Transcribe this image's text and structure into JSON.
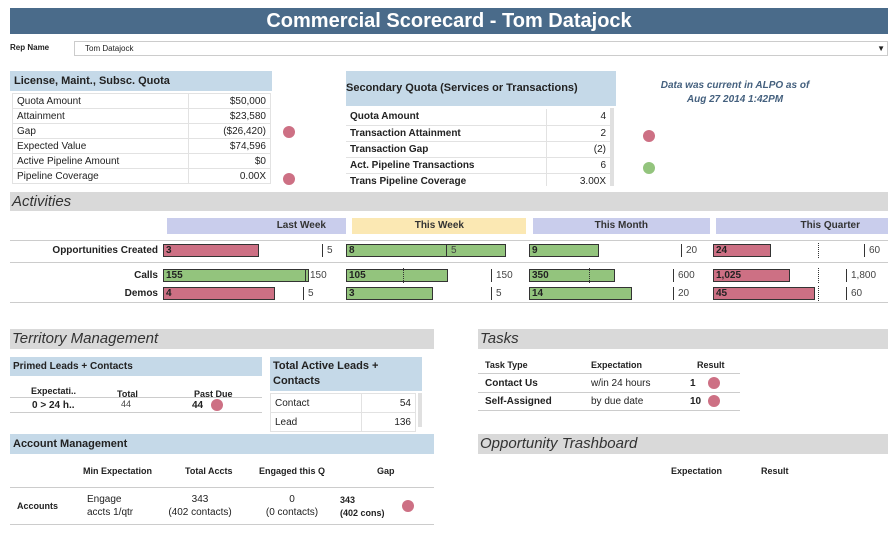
{
  "title": "Commercial Scorecard - Tom Datajock",
  "rep": {
    "label": "Rep Name",
    "value": "Tom Datajock"
  },
  "license_quota": {
    "header": "License, Maint., Subsc. Quota",
    "rows": [
      {
        "label": "Quota Amount",
        "value": "$50,000"
      },
      {
        "label": "Attainment",
        "value": "$23,580"
      },
      {
        "label": "Gap",
        "value": "($26,420)"
      },
      {
        "label": "Expected Value",
        "value": "$74,596"
      },
      {
        "label": "Active Pipeline Amount",
        "value": "$0"
      },
      {
        "label": "Pipeline Coverage",
        "value": "0.00X"
      }
    ]
  },
  "secondary_quota": {
    "header": "Secondary Quota (Services or Transactions)",
    "rows": [
      {
        "label": "Quota Amount",
        "value": "4"
      },
      {
        "label": "Transaction Attainment",
        "value": "2"
      },
      {
        "label": "Transaction Gap",
        "value": "(2)"
      },
      {
        "label": "Act. Pipeline Transactions",
        "value": "6"
      },
      {
        "label": "Trans Pipeline Coverage",
        "value": "3.00X"
      }
    ]
  },
  "data_note": {
    "line1": "Data was current in ALPO as of",
    "line2": "Aug 27 2014  1:42PM"
  },
  "activities": {
    "header": "Activities",
    "periods": [
      "Last Week",
      "This Week",
      "This Month",
      "This Quarter"
    ],
    "period_colors": [
      "#c9cdec",
      "#fbe8b3",
      "#c9cdec",
      "#c9cdec"
    ],
    "rows": [
      {
        "label": "Opportunities Created",
        "cells": [
          {
            "value": "3",
            "target": "5",
            "status": "red",
            "fill": 0.6
          },
          {
            "value": "8",
            "target": "",
            "mark_label": "5",
            "status": "green",
            "fill": 1.0
          },
          {
            "value": "9",
            "target": "20",
            "status": "green",
            "fill": 0.45
          },
          {
            "value": "24",
            "target": "60",
            "status": "red",
            "fill": 0.4
          }
        ]
      },
      {
        "label": "Calls",
        "cells": [
          {
            "value": "155",
            "target": "150",
            "status": "green",
            "fill": 1.0
          },
          {
            "value": "105",
            "target": "150",
            "status": "green",
            "fill": 0.7
          },
          {
            "value": "350",
            "target": "600",
            "status": "green",
            "fill": 0.58
          },
          {
            "value": "1,025",
            "target": "1,800",
            "status": "red",
            "fill": 0.57
          }
        ]
      },
      {
        "label": "Demos",
        "cells": [
          {
            "value": "4",
            "target": "5",
            "status": "red",
            "fill": 0.8
          },
          {
            "value": "3",
            "target": "5",
            "status": "green",
            "fill": 0.6
          },
          {
            "value": "14",
            "target": "20",
            "status": "green",
            "fill": 0.7
          },
          {
            "value": "45",
            "target": "60",
            "status": "red",
            "fill": 0.75
          }
        ]
      }
    ]
  },
  "territory": {
    "header": "Territory Management",
    "primed": {
      "header": "Primed Leads + Contacts",
      "col1": "Expectati..",
      "col2": "Total",
      "col3": "Past Due",
      "val1": "0 > 24 h..",
      "val2": "44",
      "val3": "44"
    },
    "active": {
      "header": "Total Active Leads + Contacts",
      "rows": [
        {
          "label": "Contact",
          "value": "54"
        },
        {
          "label": "Lead",
          "value": "136"
        }
      ]
    }
  },
  "account_mgmt": {
    "header": "Account Management",
    "columns": [
      "Min Expectation",
      "Total Accts",
      "Engaged this Q",
      "Gap"
    ],
    "row": {
      "label": "Accounts",
      "min_exp_1": "Engage",
      "min_exp_2": "accts 1/qtr",
      "total_1": "343",
      "total_2": "(402 contacts)",
      "engaged_1": "0",
      "engaged_2": "(0 contacts)",
      "gap_1": "343",
      "gap_2": "(402 cons)"
    }
  },
  "tasks": {
    "header": "Tasks",
    "columns": [
      "Task Type",
      "Expectation",
      "Result"
    ],
    "rows": [
      {
        "type": "Contact Us",
        "expectation": "w/in 24 hours",
        "result": "1"
      },
      {
        "type": "Self-Assigned",
        "expectation": "by due date",
        "result": "10"
      }
    ]
  },
  "trashboard": {
    "header": "Opportunity Trashboard",
    "columns": [
      "Expectation",
      "Result"
    ]
  }
}
